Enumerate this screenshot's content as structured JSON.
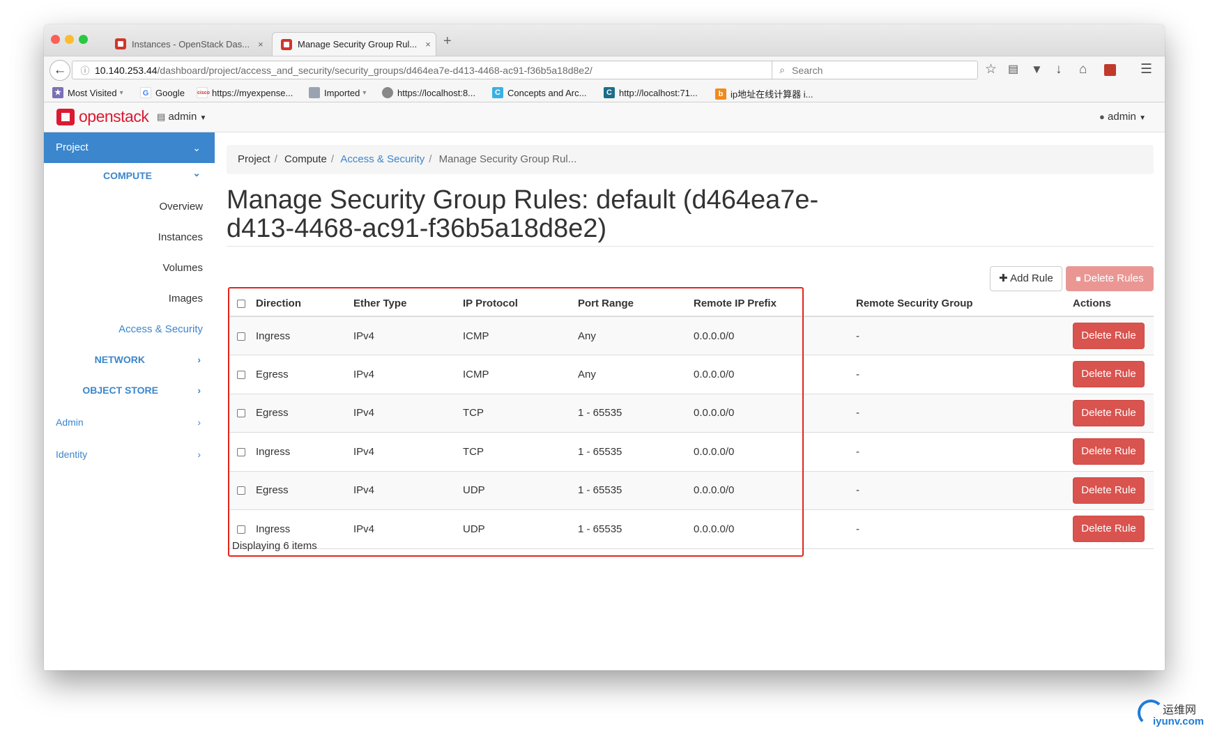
{
  "browser": {
    "tabs": [
      {
        "label": "Instances - OpenStack Das...",
        "close": "×"
      },
      {
        "label": "Manage Security Group Rul...",
        "close": "×"
      }
    ],
    "new_tab": "+",
    "url_host": "10.140.253.44",
    "url_path": "/dashboard/project/access_and_security/security_groups/d464ea7e-d413-4468-ac91-f36b5a18d8e2/",
    "search_placeholder": "Search",
    "bookmarks": [
      {
        "label": "Most Visited",
        "icon": "bookmark-folder-icon",
        "dropdown": true
      },
      {
        "label": "Google",
        "icon": "google-icon"
      },
      {
        "label": "https://myexpense...",
        "icon": "cisco-icon"
      },
      {
        "label": "Imported",
        "icon": "folder-icon",
        "dropdown": true
      },
      {
        "label": "https://localhost:8...",
        "icon": "globe-icon"
      },
      {
        "label": "Concepts and Arc...",
        "icon": "confluence-icon"
      },
      {
        "label": "http://localhost:71...",
        "icon": "c-site-icon"
      },
      {
        "label": "ip地址在线计算器 i...",
        "icon": "bing-icon"
      }
    ]
  },
  "topbar": {
    "brand": "openstack",
    "project_selector": "admin",
    "user_menu": "admin"
  },
  "sidebar": {
    "project": "Project",
    "compute": "COMPUTE",
    "compute_items": [
      "Overview",
      "Instances",
      "Volumes",
      "Images",
      "Access & Security"
    ],
    "network": "NETWORK",
    "object_store": "OBJECT STORE",
    "admin": "Admin",
    "identity": "Identity"
  },
  "breadcrumb": {
    "project": "Project",
    "compute": "Compute",
    "access": "Access & Security",
    "current": "Manage Security Group Rul..."
  },
  "page": {
    "title": "Manage Security Group Rules: default (d464ea7e-d413-4468-ac91-f36b5a18d8e2)",
    "add_rule": "Add Rule",
    "delete_rules": "Delete Rules"
  },
  "table": {
    "headers": [
      "Direction",
      "Ether Type",
      "IP Protocol",
      "Port Range",
      "Remote IP Prefix",
      "Remote Security Group",
      "Actions"
    ],
    "rows": [
      [
        "Ingress",
        "IPv4",
        "ICMP",
        "Any",
        "0.0.0.0/0",
        "-",
        "Delete Rule"
      ],
      [
        "Egress",
        "IPv4",
        "ICMP",
        "Any",
        "0.0.0.0/0",
        "-",
        "Delete Rule"
      ],
      [
        "Egress",
        "IPv4",
        "TCP",
        "1 - 65535",
        "0.0.0.0/0",
        "-",
        "Delete Rule"
      ],
      [
        "Ingress",
        "IPv4",
        "TCP",
        "1 - 65535",
        "0.0.0.0/0",
        "-",
        "Delete Rule"
      ],
      [
        "Egress",
        "IPv4",
        "UDP",
        "1 - 65535",
        "0.0.0.0/0",
        "-",
        "Delete Rule"
      ],
      [
        "Ingress",
        "IPv4",
        "UDP",
        "1 - 65535",
        "0.0.0.0/0",
        "-",
        "Delete Rule"
      ]
    ],
    "footer": "Displaying 6 items"
  },
  "watermark": {
    "line1": "运维网",
    "line2": "iyunv.com"
  },
  "colors": {
    "accent": "#3b86cc",
    "danger": "#d9534f",
    "highlight": "#e3241b",
    "brand": "#da1a32"
  }
}
